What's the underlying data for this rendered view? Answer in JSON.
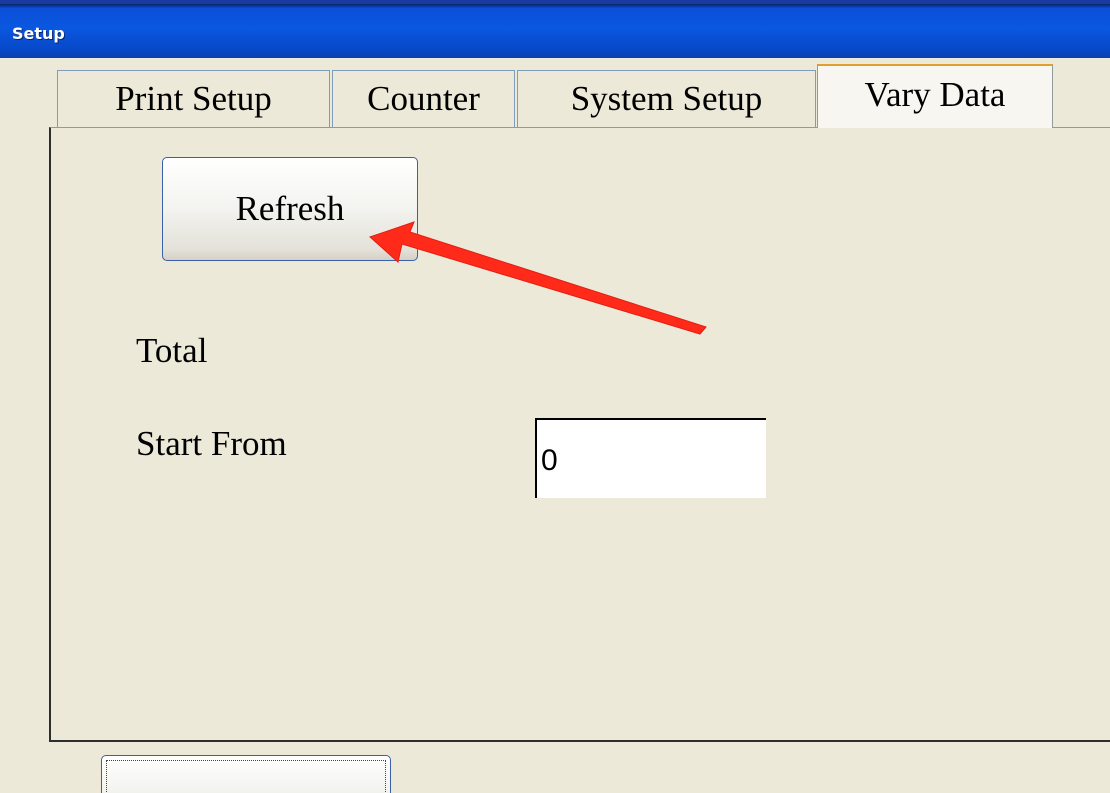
{
  "window": {
    "title": "Setup"
  },
  "tabs": [
    {
      "label": "Print Setup",
      "active": false
    },
    {
      "label": "Counter",
      "active": false
    },
    {
      "label": "System Setup",
      "active": false
    },
    {
      "label": "Vary Data",
      "active": true
    }
  ],
  "panel": {
    "refresh_label": "Refresh",
    "total_label": "Total",
    "start_from_label": "Start From",
    "start_from_value": "0"
  },
  "annotation": {
    "arrow_color": "#ff2a1a",
    "points_to": "refresh-button"
  },
  "colors": {
    "titlebar": "#0a57e0",
    "window_bg": "#ece9d8",
    "button_border": "#3b5fa8"
  }
}
